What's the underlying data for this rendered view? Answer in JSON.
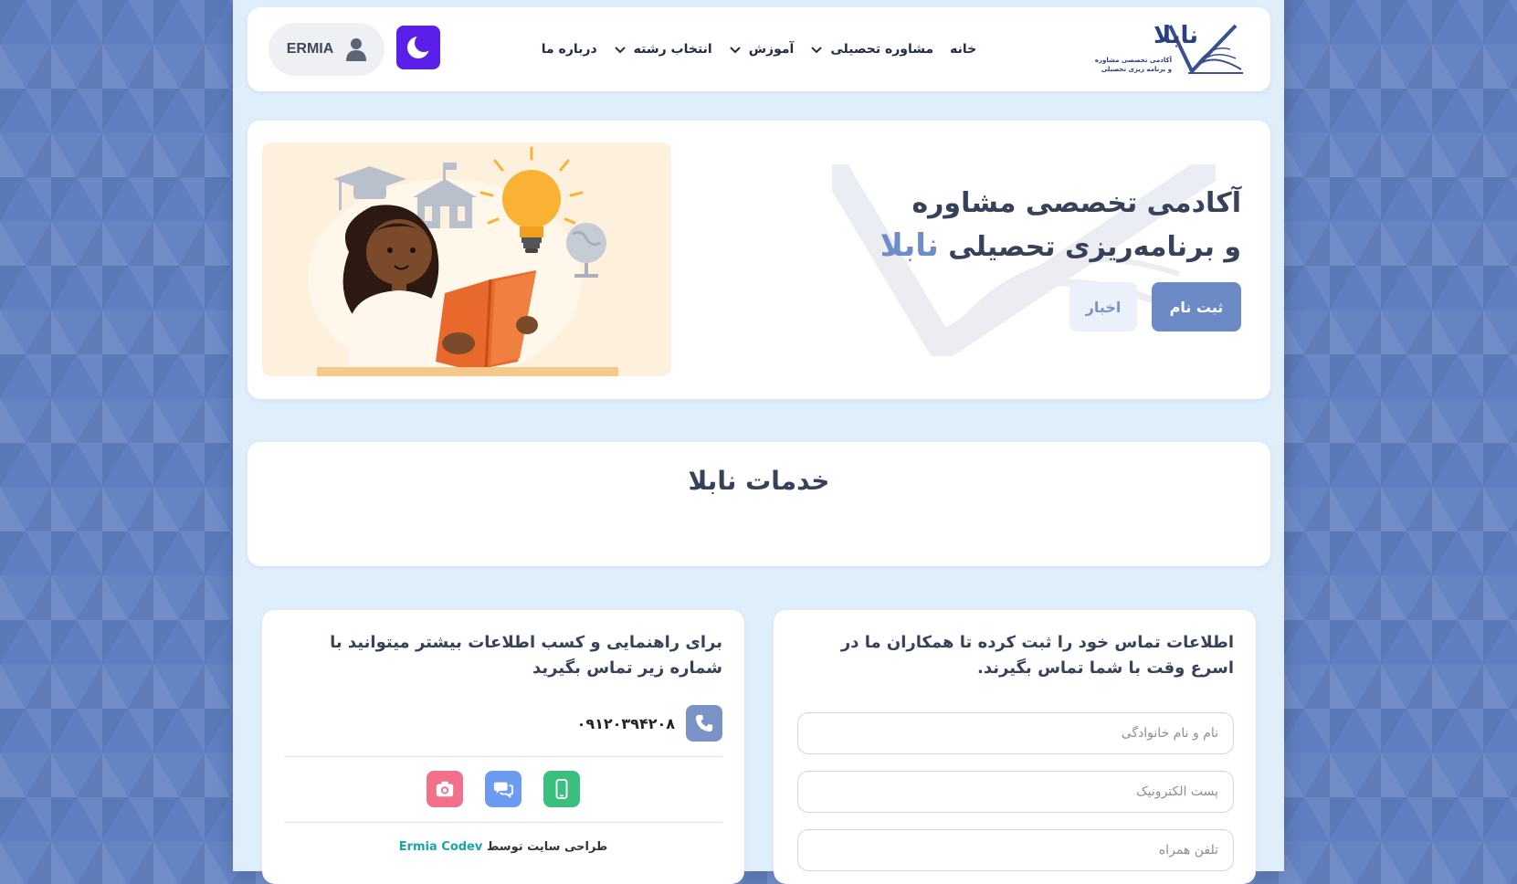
{
  "header": {
    "logo_text": "نابلا",
    "logo_subtitle_1": "آکادمی تخصصی مشاوره",
    "logo_subtitle_2": "و برنامه ریزی تحصیلی",
    "nav": [
      {
        "label": "خانه",
        "has_dropdown": false
      },
      {
        "label": "مشاوره تحصیلی",
        "has_dropdown": true
      },
      {
        "label": "آموزش",
        "has_dropdown": true
      },
      {
        "label": "انتخاب رشته",
        "has_dropdown": true
      },
      {
        "label": "درباره ما",
        "has_dropdown": false
      }
    ],
    "theme_toggle_icon": "moon-icon",
    "user_name": "ERMIA",
    "user_icon": "user-icon",
    "accent_color": "#5a20ea"
  },
  "hero": {
    "title_line1": "آکادمی تخصصی مشاوره",
    "title_line2": "و برنامه‌ریزی تحصیلی",
    "brand_word": "نابلا",
    "register_label": "ثبت نام",
    "news_label": "اخبار",
    "primary_color": "#6c8ac5"
  },
  "services": {
    "title": "خدمات نابلا"
  },
  "contact_form": {
    "intro": "اطلاعات تماس خود را ثبت کرده تا همکاران ما در اسرع وقت با شما تماس بگیرند.",
    "name_placeholder": "نام و نام خانوادگی",
    "email_placeholder": "پست الکترونیک",
    "phone_placeholder": "تلفن همراه"
  },
  "contact_info": {
    "intro": "برای راهنمایی و کسب اطلاعات بیشتر میتوانید با شماره زیر تماس بگیرید",
    "phone": "۰۹۱۲۰۳۹۴۲۰۸",
    "socials": [
      {
        "icon": "mobile-icon",
        "color": "#3bbf7f"
      },
      {
        "icon": "chat-icon",
        "color": "#6b9bf0"
      },
      {
        "icon": "instagram-icon",
        "color": "#f2718a"
      }
    ],
    "credit_prefix": "طراحی سایت توسط",
    "credit_name": "Ermia Codev"
  }
}
